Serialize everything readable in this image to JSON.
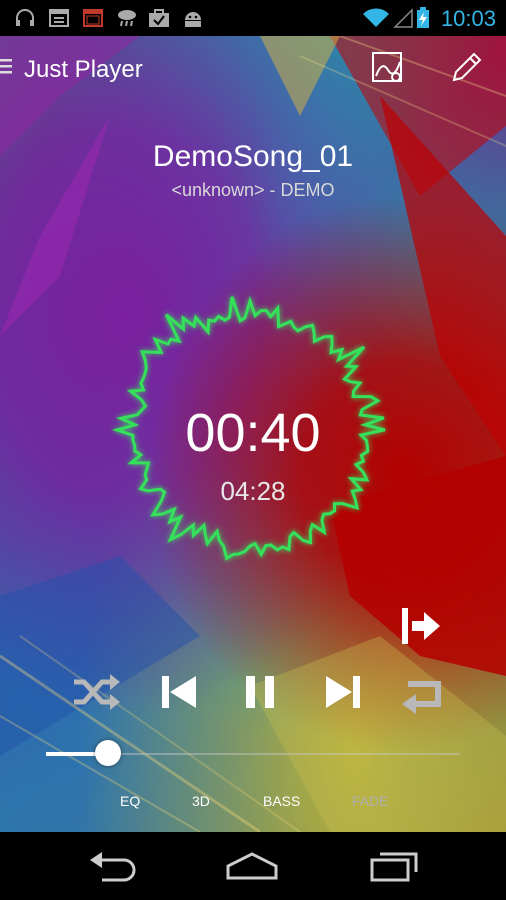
{
  "status_bar": {
    "time": "10:03",
    "left_icons": [
      "headphones-icon",
      "calendar-icon",
      "calendar-red-icon",
      "cloud-rain-icon",
      "briefcase-check-icon",
      "android-icon"
    ],
    "right_icons": [
      "wifi-icon",
      "signal-icon",
      "battery-charging-icon"
    ],
    "accent": "#33b5e5"
  },
  "action_bar": {
    "title": "Just Player",
    "actions": [
      "visualizer-image-icon",
      "edit-pencil-icon"
    ]
  },
  "track": {
    "title": "DemoSong_01",
    "subtitle": "<unknown> - DEMO"
  },
  "playback": {
    "current_time": "00:40",
    "total_time": "04:28",
    "progress": 0.149
  },
  "controls": [
    "shuffle-icon",
    "previous-icon",
    "pause-icon",
    "next-icon",
    "repeat-icon",
    "queue-next-icon"
  ],
  "effects": {
    "eq": "EQ",
    "three_d": "3D",
    "bass": "BASS",
    "fade": "FADE"
  },
  "nav": [
    "back-icon",
    "home-icon",
    "recent-apps-icon"
  ],
  "colors": {
    "visualizer_glow": "#36e05a"
  }
}
